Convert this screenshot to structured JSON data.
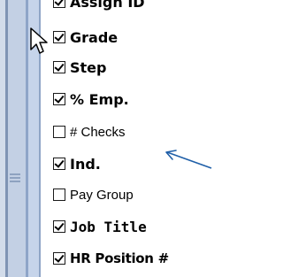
{
  "field_list": {
    "items": [
      {
        "label": "Assign ID",
        "checked": true,
        "style": "bold"
      },
      {
        "label": "Grade",
        "checked": true,
        "style": "bold"
      },
      {
        "label": "Step",
        "checked": true,
        "style": "bold"
      },
      {
        "label": "% Emp.",
        "checked": true,
        "style": "bold"
      },
      {
        "label": "# Checks",
        "checked": false,
        "style": "plain"
      },
      {
        "label": "Ind.",
        "checked": true,
        "style": "bold"
      },
      {
        "label": "Pay Group",
        "checked": false,
        "style": "plain"
      },
      {
        "label": "Job Title",
        "checked": true,
        "style": "mono"
      },
      {
        "label": "HR Position #",
        "checked": true,
        "style": "cond"
      }
    ]
  },
  "annotation": {
    "arrow_color": "#1f5fa8",
    "points_to": "# Checks"
  },
  "colors": {
    "splitter_dark": "#7f94b4",
    "splitter_light": "#c3d0e4"
  },
  "icons": {
    "cursor": "mouse-pointer-icon",
    "grip": "splitter-grip-icon",
    "arrow": "annotation-arrow-icon"
  }
}
